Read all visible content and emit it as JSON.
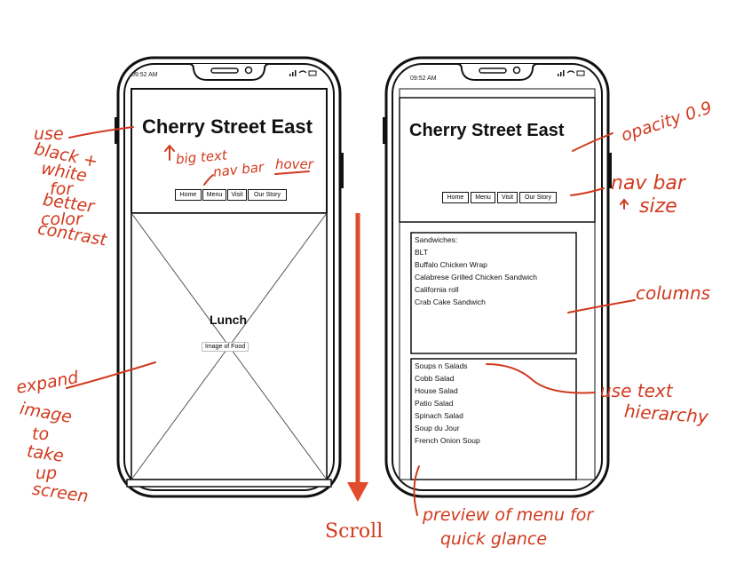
{
  "phone1": {
    "time": "09:52 AM",
    "site_title": "Cherry Street East",
    "nav": [
      "Home",
      "Menu",
      "Visit",
      "Our Story"
    ],
    "hero_heading": "Lunch",
    "hero_caption": "Image of Food"
  },
  "phone2": {
    "time": "09:52 AM",
    "site_title": "Cherry Street East",
    "nav": [
      "Home",
      "Menu",
      "Visit",
      "Our Story"
    ],
    "sandwiches": {
      "heading": "Sandwiches:",
      "items": [
        "BLT",
        "Buffalo Chicken Wrap",
        "Calabrese Grilled Chicken Sandwich",
        "California roll",
        "Crab Cake Sandwich"
      ]
    },
    "soups": {
      "heading": "Soups n Salads",
      "items": [
        "Cobb Salad",
        "House Salad",
        "Patio Salad",
        "Spinach Salad",
        "Soup du Jour",
        "French Onion Soup"
      ]
    }
  },
  "annotations": {
    "left_contrast": [
      "use",
      "black +",
      "white",
      "for",
      "better",
      "color",
      "contrast"
    ],
    "big_text": "big text",
    "nav_hover_a": "nav bar",
    "nav_hover_b": "hover",
    "expand": [
      "expand",
      "image",
      "to",
      "take",
      "up",
      "screen"
    ],
    "opacity": "opacity 0.9",
    "nav_size_a": "nav bar",
    "nav_size_b": "size",
    "columns": "columns",
    "hierarchy_a": "use text",
    "hierarchy_b": "hierarchy",
    "preview_a": "preview of menu for",
    "preview_b": "quick glance",
    "scroll": "Scroll"
  },
  "colors": {
    "annotation": "#d13a1e",
    "outline": "#111111"
  }
}
